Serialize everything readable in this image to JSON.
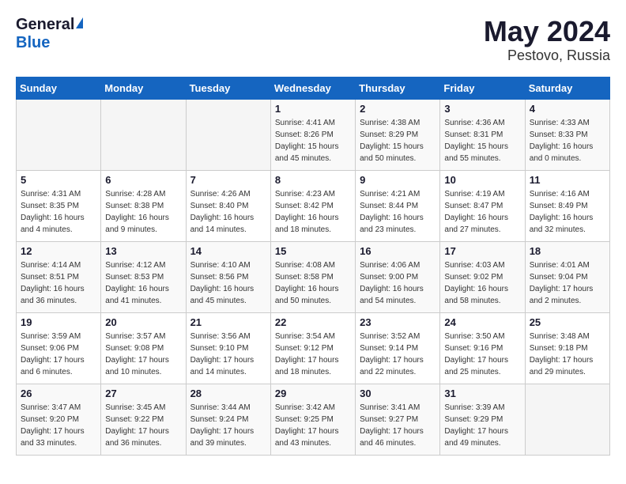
{
  "header": {
    "logo_general": "General",
    "logo_blue": "Blue",
    "month_year": "May 2024",
    "location": "Pestovo, Russia"
  },
  "days_of_week": [
    "Sunday",
    "Monday",
    "Tuesday",
    "Wednesday",
    "Thursday",
    "Friday",
    "Saturday"
  ],
  "weeks": [
    [
      {
        "day": "",
        "info": ""
      },
      {
        "day": "",
        "info": ""
      },
      {
        "day": "",
        "info": ""
      },
      {
        "day": "1",
        "info": "Sunrise: 4:41 AM\nSunset: 8:26 PM\nDaylight: 15 hours\nand 45 minutes."
      },
      {
        "day": "2",
        "info": "Sunrise: 4:38 AM\nSunset: 8:29 PM\nDaylight: 15 hours\nand 50 minutes."
      },
      {
        "day": "3",
        "info": "Sunrise: 4:36 AM\nSunset: 8:31 PM\nDaylight: 15 hours\nand 55 minutes."
      },
      {
        "day": "4",
        "info": "Sunrise: 4:33 AM\nSunset: 8:33 PM\nDaylight: 16 hours\nand 0 minutes."
      }
    ],
    [
      {
        "day": "5",
        "info": "Sunrise: 4:31 AM\nSunset: 8:35 PM\nDaylight: 16 hours\nand 4 minutes."
      },
      {
        "day": "6",
        "info": "Sunrise: 4:28 AM\nSunset: 8:38 PM\nDaylight: 16 hours\nand 9 minutes."
      },
      {
        "day": "7",
        "info": "Sunrise: 4:26 AM\nSunset: 8:40 PM\nDaylight: 16 hours\nand 14 minutes."
      },
      {
        "day": "8",
        "info": "Sunrise: 4:23 AM\nSunset: 8:42 PM\nDaylight: 16 hours\nand 18 minutes."
      },
      {
        "day": "9",
        "info": "Sunrise: 4:21 AM\nSunset: 8:44 PM\nDaylight: 16 hours\nand 23 minutes."
      },
      {
        "day": "10",
        "info": "Sunrise: 4:19 AM\nSunset: 8:47 PM\nDaylight: 16 hours\nand 27 minutes."
      },
      {
        "day": "11",
        "info": "Sunrise: 4:16 AM\nSunset: 8:49 PM\nDaylight: 16 hours\nand 32 minutes."
      }
    ],
    [
      {
        "day": "12",
        "info": "Sunrise: 4:14 AM\nSunset: 8:51 PM\nDaylight: 16 hours\nand 36 minutes."
      },
      {
        "day": "13",
        "info": "Sunrise: 4:12 AM\nSunset: 8:53 PM\nDaylight: 16 hours\nand 41 minutes."
      },
      {
        "day": "14",
        "info": "Sunrise: 4:10 AM\nSunset: 8:56 PM\nDaylight: 16 hours\nand 45 minutes."
      },
      {
        "day": "15",
        "info": "Sunrise: 4:08 AM\nSunset: 8:58 PM\nDaylight: 16 hours\nand 50 minutes."
      },
      {
        "day": "16",
        "info": "Sunrise: 4:06 AM\nSunset: 9:00 PM\nDaylight: 16 hours\nand 54 minutes."
      },
      {
        "day": "17",
        "info": "Sunrise: 4:03 AM\nSunset: 9:02 PM\nDaylight: 16 hours\nand 58 minutes."
      },
      {
        "day": "18",
        "info": "Sunrise: 4:01 AM\nSunset: 9:04 PM\nDaylight: 17 hours\nand 2 minutes."
      }
    ],
    [
      {
        "day": "19",
        "info": "Sunrise: 3:59 AM\nSunset: 9:06 PM\nDaylight: 17 hours\nand 6 minutes."
      },
      {
        "day": "20",
        "info": "Sunrise: 3:57 AM\nSunset: 9:08 PM\nDaylight: 17 hours\nand 10 minutes."
      },
      {
        "day": "21",
        "info": "Sunrise: 3:56 AM\nSunset: 9:10 PM\nDaylight: 17 hours\nand 14 minutes."
      },
      {
        "day": "22",
        "info": "Sunrise: 3:54 AM\nSunset: 9:12 PM\nDaylight: 17 hours\nand 18 minutes."
      },
      {
        "day": "23",
        "info": "Sunrise: 3:52 AM\nSunset: 9:14 PM\nDaylight: 17 hours\nand 22 minutes."
      },
      {
        "day": "24",
        "info": "Sunrise: 3:50 AM\nSunset: 9:16 PM\nDaylight: 17 hours\nand 25 minutes."
      },
      {
        "day": "25",
        "info": "Sunrise: 3:48 AM\nSunset: 9:18 PM\nDaylight: 17 hours\nand 29 minutes."
      }
    ],
    [
      {
        "day": "26",
        "info": "Sunrise: 3:47 AM\nSunset: 9:20 PM\nDaylight: 17 hours\nand 33 minutes."
      },
      {
        "day": "27",
        "info": "Sunrise: 3:45 AM\nSunset: 9:22 PM\nDaylight: 17 hours\nand 36 minutes."
      },
      {
        "day": "28",
        "info": "Sunrise: 3:44 AM\nSunset: 9:24 PM\nDaylight: 17 hours\nand 39 minutes."
      },
      {
        "day": "29",
        "info": "Sunrise: 3:42 AM\nSunset: 9:25 PM\nDaylight: 17 hours\nand 43 minutes."
      },
      {
        "day": "30",
        "info": "Sunrise: 3:41 AM\nSunset: 9:27 PM\nDaylight: 17 hours\nand 46 minutes."
      },
      {
        "day": "31",
        "info": "Sunrise: 3:39 AM\nSunset: 9:29 PM\nDaylight: 17 hours\nand 49 minutes."
      },
      {
        "day": "",
        "info": ""
      }
    ]
  ]
}
